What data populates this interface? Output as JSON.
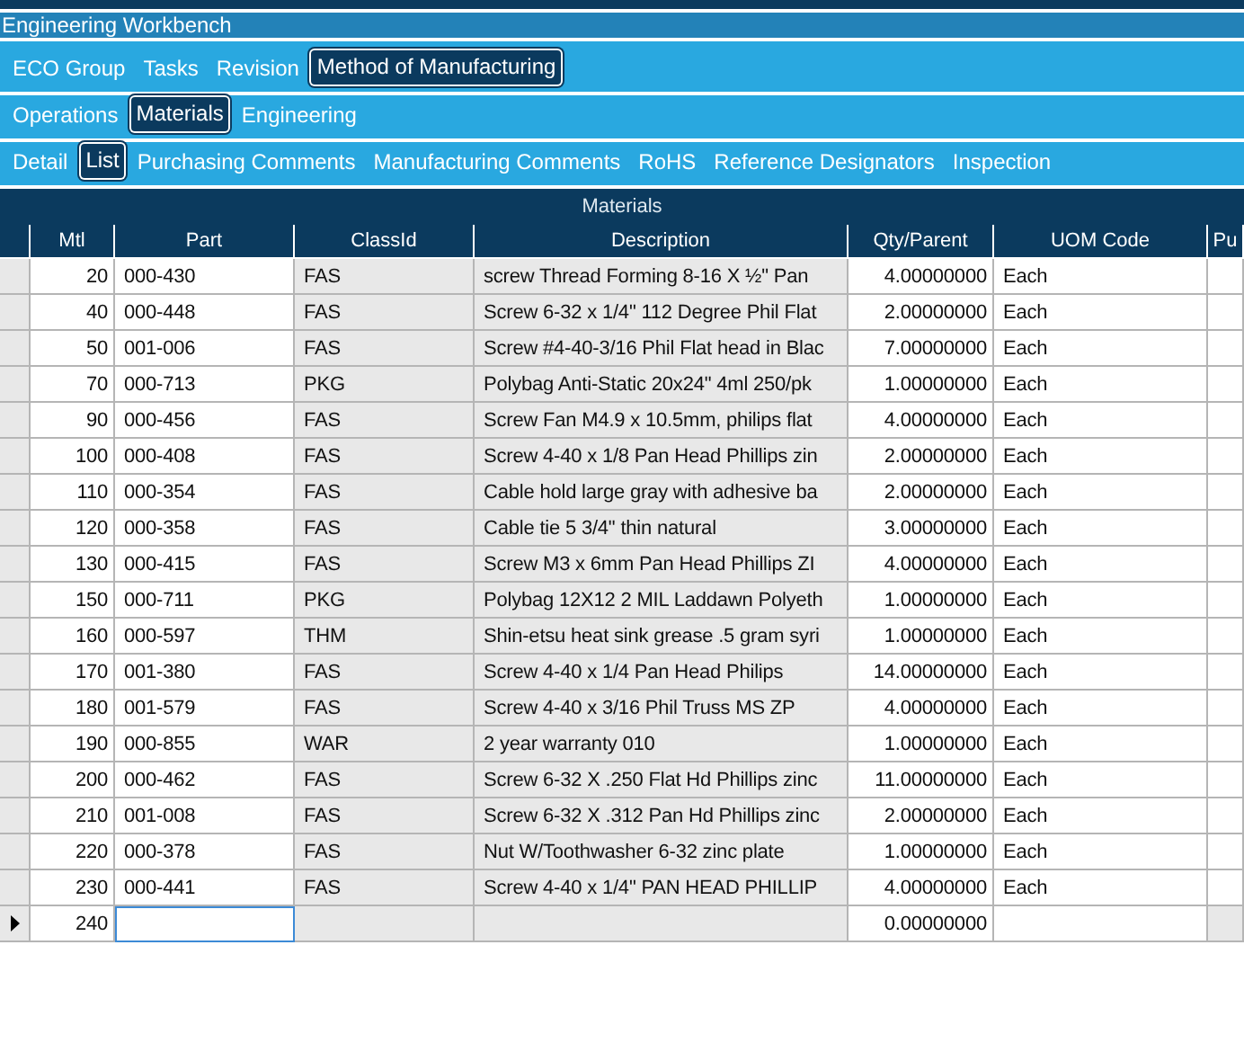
{
  "window": {
    "title": "Engineering Workbench"
  },
  "tab_levels": [
    [
      {
        "label": "ECO Group",
        "selected": false
      },
      {
        "label": "Tasks",
        "selected": false
      },
      {
        "label": "Revision",
        "selected": false
      },
      {
        "label": "Method of Manufacturing",
        "selected": true
      }
    ],
    [
      {
        "label": "Operations",
        "selected": false
      },
      {
        "label": "Materials",
        "selected": true
      },
      {
        "label": "Engineering",
        "selected": false
      }
    ],
    [
      {
        "label": "Detail",
        "selected": false
      },
      {
        "label": "List",
        "selected": true
      },
      {
        "label": "Purchasing Comments",
        "selected": false
      },
      {
        "label": "Manufacturing Comments",
        "selected": false
      },
      {
        "label": "RoHS",
        "selected": false
      },
      {
        "label": "Reference Designators",
        "selected": false
      },
      {
        "label": "Inspection",
        "selected": false
      }
    ]
  ],
  "grid": {
    "title": "Materials",
    "columns": [
      "Mtl",
      "Part",
      "ClassId",
      "Description",
      "Qty/Parent",
      "UOM Code",
      "Pu"
    ],
    "rows": [
      {
        "mtl": "20",
        "part": "000-430",
        "class_id": "FAS",
        "description": "screw Thread Forming 8-16 X ½\"  Pan",
        "qty": "4.00000000",
        "uom": "Each",
        "current": false
      },
      {
        "mtl": "40",
        "part": "000-448",
        "class_id": "FAS",
        "description": "Screw 6-32 x 1/4\"  112 Degree Phil Flat",
        "qty": "2.00000000",
        "uom": "Each",
        "current": false
      },
      {
        "mtl": "50",
        "part": "001-006",
        "class_id": "FAS",
        "description": "Screw #4-40-3/16 Phil Flat head in Blac",
        "qty": "7.00000000",
        "uom": "Each",
        "current": false
      },
      {
        "mtl": "70",
        "part": "000-713",
        "class_id": "PKG",
        "description": "Polybag Anti-Static 20x24\" 4ml 250/pk",
        "qty": "1.00000000",
        "uom": "Each",
        "current": false
      },
      {
        "mtl": "90",
        "part": "000-456",
        "class_id": "FAS",
        "description": "Screw Fan M4.9 x 10.5mm, philips flat",
        "qty": "4.00000000",
        "uom": "Each",
        "current": false
      },
      {
        "mtl": "100",
        "part": "000-408",
        "class_id": "FAS",
        "description": "Screw 4-40 x 1/8 Pan Head Phillips zin",
        "qty": "2.00000000",
        "uom": "Each",
        "current": false
      },
      {
        "mtl": "110",
        "part": "000-354",
        "class_id": "FAS",
        "description": "Cable hold large gray with adhesive ba",
        "qty": "2.00000000",
        "uom": "Each",
        "current": false
      },
      {
        "mtl": "120",
        "part": "000-358",
        "class_id": "FAS",
        "description": "Cable tie 5 3/4\"  thin natural",
        "qty": "3.00000000",
        "uom": "Each",
        "current": false
      },
      {
        "mtl": "130",
        "part": "000-415",
        "class_id": "FAS",
        "description": "Screw M3 x 6mm Pan Head Phillips ZI",
        "qty": "4.00000000",
        "uom": "Each",
        "current": false
      },
      {
        "mtl": "150",
        "part": "000-711",
        "class_id": "PKG",
        "description": "Polybag 12X12 2 MIL Laddawn Polyeth",
        "qty": "1.00000000",
        "uom": "Each",
        "current": false
      },
      {
        "mtl": "160",
        "part": "000-597",
        "class_id": "THM",
        "description": "Shin-etsu heat sink grease .5 gram syri",
        "qty": "1.00000000",
        "uom": "Each",
        "current": false
      },
      {
        "mtl": "170",
        "part": "001-380",
        "class_id": "FAS",
        "description": "Screw 4-40 x 1/4 Pan Head Philips",
        "qty": "14.00000000",
        "uom": "Each",
        "current": false
      },
      {
        "mtl": "180",
        "part": "001-579",
        "class_id": "FAS",
        "description": "Screw 4-40 x 3/16 Phil Truss MS ZP",
        "qty": "4.00000000",
        "uom": "Each",
        "current": false
      },
      {
        "mtl": "190",
        "part": "000-855",
        "class_id": "WAR",
        "description": "2 year warranty 010",
        "qty": "1.00000000",
        "uom": "Each",
        "current": false
      },
      {
        "mtl": "200",
        "part": "000-462",
        "class_id": "FAS",
        "description": "Screw 6-32 X .250 Flat Hd Phillips zinc",
        "qty": "11.00000000",
        "uom": "Each",
        "current": false
      },
      {
        "mtl": "210",
        "part": "001-008",
        "class_id": "FAS",
        "description": "Screw 6-32 X .312 Pan Hd Phillips zinc",
        "qty": "2.00000000",
        "uom": "Each",
        "current": false
      },
      {
        "mtl": "220",
        "part": "000-378",
        "class_id": "FAS",
        "description": "Nut W/Toothwasher 6-32 zinc plate",
        "qty": "1.00000000",
        "uom": "Each",
        "current": false
      },
      {
        "mtl": "230",
        "part": "000-441",
        "class_id": "FAS",
        "description": "Screw 4-40 x 1/4\"  PAN HEAD PHILLIP",
        "qty": "4.00000000",
        "uom": "Each",
        "current": false
      },
      {
        "mtl": "240",
        "qty": "0.00000000",
        "current": true
      }
    ]
  }
}
